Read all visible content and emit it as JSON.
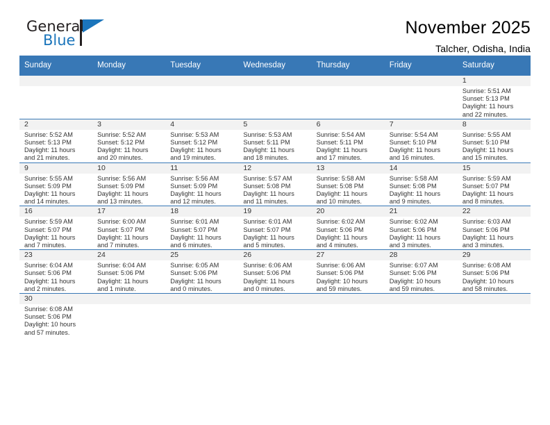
{
  "logo": {
    "word_top": "General",
    "word_bottom": "Blue",
    "accent_color": "#1b75bb"
  },
  "header": {
    "title": "November 2025",
    "subtitle": "Talcher, Odisha, India"
  },
  "calendar": {
    "header_background": "#3878b6",
    "daynum_background": "#f2f2f2",
    "weekdays": [
      "Sunday",
      "Monday",
      "Tuesday",
      "Wednesday",
      "Thursday",
      "Friday",
      "Saturday"
    ],
    "weeks": [
      [
        {
          "day": "",
          "sunrise": "",
          "sunset": "",
          "daylight_line1": "",
          "daylight_line2": "",
          "blank": true
        },
        {
          "day": "",
          "sunrise": "",
          "sunset": "",
          "daylight_line1": "",
          "daylight_line2": "",
          "blank": true
        },
        {
          "day": "",
          "sunrise": "",
          "sunset": "",
          "daylight_line1": "",
          "daylight_line2": "",
          "blank": true
        },
        {
          "day": "",
          "sunrise": "",
          "sunset": "",
          "daylight_line1": "",
          "daylight_line2": "",
          "blank": true
        },
        {
          "day": "",
          "sunrise": "",
          "sunset": "",
          "daylight_line1": "",
          "daylight_line2": "",
          "blank": true
        },
        {
          "day": "",
          "sunrise": "",
          "sunset": "",
          "daylight_line1": "",
          "daylight_line2": "",
          "blank": true
        },
        {
          "day": "1",
          "sunrise": "Sunrise: 5:51 AM",
          "sunset": "Sunset: 5:13 PM",
          "daylight_line1": "Daylight: 11 hours",
          "daylight_line2": "and 22 minutes.",
          "blank": false
        }
      ],
      [
        {
          "day": "2",
          "sunrise": "Sunrise: 5:52 AM",
          "sunset": "Sunset: 5:13 PM",
          "daylight_line1": "Daylight: 11 hours",
          "daylight_line2": "and 21 minutes.",
          "blank": false
        },
        {
          "day": "3",
          "sunrise": "Sunrise: 5:52 AM",
          "sunset": "Sunset: 5:12 PM",
          "daylight_line1": "Daylight: 11 hours",
          "daylight_line2": "and 20 minutes.",
          "blank": false
        },
        {
          "day": "4",
          "sunrise": "Sunrise: 5:53 AM",
          "sunset": "Sunset: 5:12 PM",
          "daylight_line1": "Daylight: 11 hours",
          "daylight_line2": "and 19 minutes.",
          "blank": false
        },
        {
          "day": "5",
          "sunrise": "Sunrise: 5:53 AM",
          "sunset": "Sunset: 5:11 PM",
          "daylight_line1": "Daylight: 11 hours",
          "daylight_line2": "and 18 minutes.",
          "blank": false
        },
        {
          "day": "6",
          "sunrise": "Sunrise: 5:54 AM",
          "sunset": "Sunset: 5:11 PM",
          "daylight_line1": "Daylight: 11 hours",
          "daylight_line2": "and 17 minutes.",
          "blank": false
        },
        {
          "day": "7",
          "sunrise": "Sunrise: 5:54 AM",
          "sunset": "Sunset: 5:10 PM",
          "daylight_line1": "Daylight: 11 hours",
          "daylight_line2": "and 16 minutes.",
          "blank": false
        },
        {
          "day": "8",
          "sunrise": "Sunrise: 5:55 AM",
          "sunset": "Sunset: 5:10 PM",
          "daylight_line1": "Daylight: 11 hours",
          "daylight_line2": "and 15 minutes.",
          "blank": false
        }
      ],
      [
        {
          "day": "9",
          "sunrise": "Sunrise: 5:55 AM",
          "sunset": "Sunset: 5:09 PM",
          "daylight_line1": "Daylight: 11 hours",
          "daylight_line2": "and 14 minutes.",
          "blank": false
        },
        {
          "day": "10",
          "sunrise": "Sunrise: 5:56 AM",
          "sunset": "Sunset: 5:09 PM",
          "daylight_line1": "Daylight: 11 hours",
          "daylight_line2": "and 13 minutes.",
          "blank": false
        },
        {
          "day": "11",
          "sunrise": "Sunrise: 5:56 AM",
          "sunset": "Sunset: 5:09 PM",
          "daylight_line1": "Daylight: 11 hours",
          "daylight_line2": "and 12 minutes.",
          "blank": false
        },
        {
          "day": "12",
          "sunrise": "Sunrise: 5:57 AM",
          "sunset": "Sunset: 5:08 PM",
          "daylight_line1": "Daylight: 11 hours",
          "daylight_line2": "and 11 minutes.",
          "blank": false
        },
        {
          "day": "13",
          "sunrise": "Sunrise: 5:58 AM",
          "sunset": "Sunset: 5:08 PM",
          "daylight_line1": "Daylight: 11 hours",
          "daylight_line2": "and 10 minutes.",
          "blank": false
        },
        {
          "day": "14",
          "sunrise": "Sunrise: 5:58 AM",
          "sunset": "Sunset: 5:08 PM",
          "daylight_line1": "Daylight: 11 hours",
          "daylight_line2": "and 9 minutes.",
          "blank": false
        },
        {
          "day": "15",
          "sunrise": "Sunrise: 5:59 AM",
          "sunset": "Sunset: 5:07 PM",
          "daylight_line1": "Daylight: 11 hours",
          "daylight_line2": "and 8 minutes.",
          "blank": false
        }
      ],
      [
        {
          "day": "16",
          "sunrise": "Sunrise: 5:59 AM",
          "sunset": "Sunset: 5:07 PM",
          "daylight_line1": "Daylight: 11 hours",
          "daylight_line2": "and 7 minutes.",
          "blank": false
        },
        {
          "day": "17",
          "sunrise": "Sunrise: 6:00 AM",
          "sunset": "Sunset: 5:07 PM",
          "daylight_line1": "Daylight: 11 hours",
          "daylight_line2": "and 7 minutes.",
          "blank": false
        },
        {
          "day": "18",
          "sunrise": "Sunrise: 6:01 AM",
          "sunset": "Sunset: 5:07 PM",
          "daylight_line1": "Daylight: 11 hours",
          "daylight_line2": "and 6 minutes.",
          "blank": false
        },
        {
          "day": "19",
          "sunrise": "Sunrise: 6:01 AM",
          "sunset": "Sunset: 5:07 PM",
          "daylight_line1": "Daylight: 11 hours",
          "daylight_line2": "and 5 minutes.",
          "blank": false
        },
        {
          "day": "20",
          "sunrise": "Sunrise: 6:02 AM",
          "sunset": "Sunset: 5:06 PM",
          "daylight_line1": "Daylight: 11 hours",
          "daylight_line2": "and 4 minutes.",
          "blank": false
        },
        {
          "day": "21",
          "sunrise": "Sunrise: 6:02 AM",
          "sunset": "Sunset: 5:06 PM",
          "daylight_line1": "Daylight: 11 hours",
          "daylight_line2": "and 3 minutes.",
          "blank": false
        },
        {
          "day": "22",
          "sunrise": "Sunrise: 6:03 AM",
          "sunset": "Sunset: 5:06 PM",
          "daylight_line1": "Daylight: 11 hours",
          "daylight_line2": "and 3 minutes.",
          "blank": false
        }
      ],
      [
        {
          "day": "23",
          "sunrise": "Sunrise: 6:04 AM",
          "sunset": "Sunset: 5:06 PM",
          "daylight_line1": "Daylight: 11 hours",
          "daylight_line2": "and 2 minutes.",
          "blank": false
        },
        {
          "day": "24",
          "sunrise": "Sunrise: 6:04 AM",
          "sunset": "Sunset: 5:06 PM",
          "daylight_line1": "Daylight: 11 hours",
          "daylight_line2": "and 1 minute.",
          "blank": false
        },
        {
          "day": "25",
          "sunrise": "Sunrise: 6:05 AM",
          "sunset": "Sunset: 5:06 PM",
          "daylight_line1": "Daylight: 11 hours",
          "daylight_line2": "and 0 minutes.",
          "blank": false
        },
        {
          "day": "26",
          "sunrise": "Sunrise: 6:06 AM",
          "sunset": "Sunset: 5:06 PM",
          "daylight_line1": "Daylight: 11 hours",
          "daylight_line2": "and 0 minutes.",
          "blank": false
        },
        {
          "day": "27",
          "sunrise": "Sunrise: 6:06 AM",
          "sunset": "Sunset: 5:06 PM",
          "daylight_line1": "Daylight: 10 hours",
          "daylight_line2": "and 59 minutes.",
          "blank": false
        },
        {
          "day": "28",
          "sunrise": "Sunrise: 6:07 AM",
          "sunset": "Sunset: 5:06 PM",
          "daylight_line1": "Daylight: 10 hours",
          "daylight_line2": "and 59 minutes.",
          "blank": false
        },
        {
          "day": "29",
          "sunrise": "Sunrise: 6:08 AM",
          "sunset": "Sunset: 5:06 PM",
          "daylight_line1": "Daylight: 10 hours",
          "daylight_line2": "and 58 minutes.",
          "blank": false
        }
      ],
      [
        {
          "day": "30",
          "sunrise": "Sunrise: 6:08 AM",
          "sunset": "Sunset: 5:06 PM",
          "daylight_line1": "Daylight: 10 hours",
          "daylight_line2": "and 57 minutes.",
          "blank": false
        },
        {
          "day": "",
          "sunrise": "",
          "sunset": "",
          "daylight_line1": "",
          "daylight_line2": "",
          "blank": true
        },
        {
          "day": "",
          "sunrise": "",
          "sunset": "",
          "daylight_line1": "",
          "daylight_line2": "",
          "blank": true
        },
        {
          "day": "",
          "sunrise": "",
          "sunset": "",
          "daylight_line1": "",
          "daylight_line2": "",
          "blank": true
        },
        {
          "day": "",
          "sunrise": "",
          "sunset": "",
          "daylight_line1": "",
          "daylight_line2": "",
          "blank": true
        },
        {
          "day": "",
          "sunrise": "",
          "sunset": "",
          "daylight_line1": "",
          "daylight_line2": "",
          "blank": true
        },
        {
          "day": "",
          "sunrise": "",
          "sunset": "",
          "daylight_line1": "",
          "daylight_line2": "",
          "blank": true
        }
      ]
    ]
  }
}
